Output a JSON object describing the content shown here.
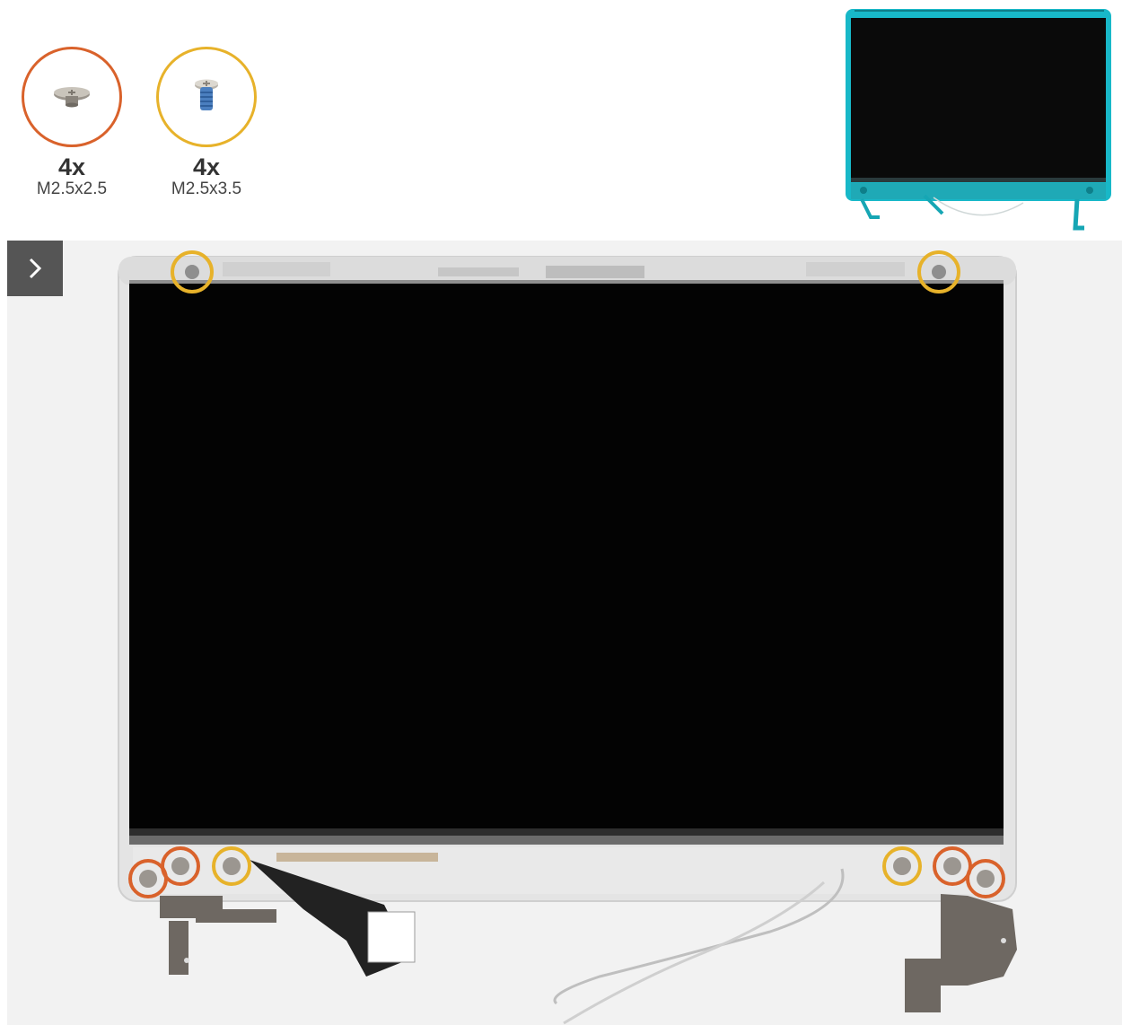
{
  "screws": [
    {
      "quantity": "4x",
      "size": "M2.5x2.5",
      "ring_color": "#d9622b",
      "icon": "short-screw-icon"
    },
    {
      "quantity": "4x",
      "size": "M2.5x3.5",
      "ring_color": "#e7b22a",
      "icon": "long-screw-icon"
    }
  ],
  "controls": {
    "next_icon": "chevron-right-icon"
  },
  "colors": {
    "orange_marker": "#d9622b",
    "yellow_marker": "#e7b22a",
    "highlight_cyan": "#18b8c8",
    "panel_background": "#f2f2f2"
  }
}
